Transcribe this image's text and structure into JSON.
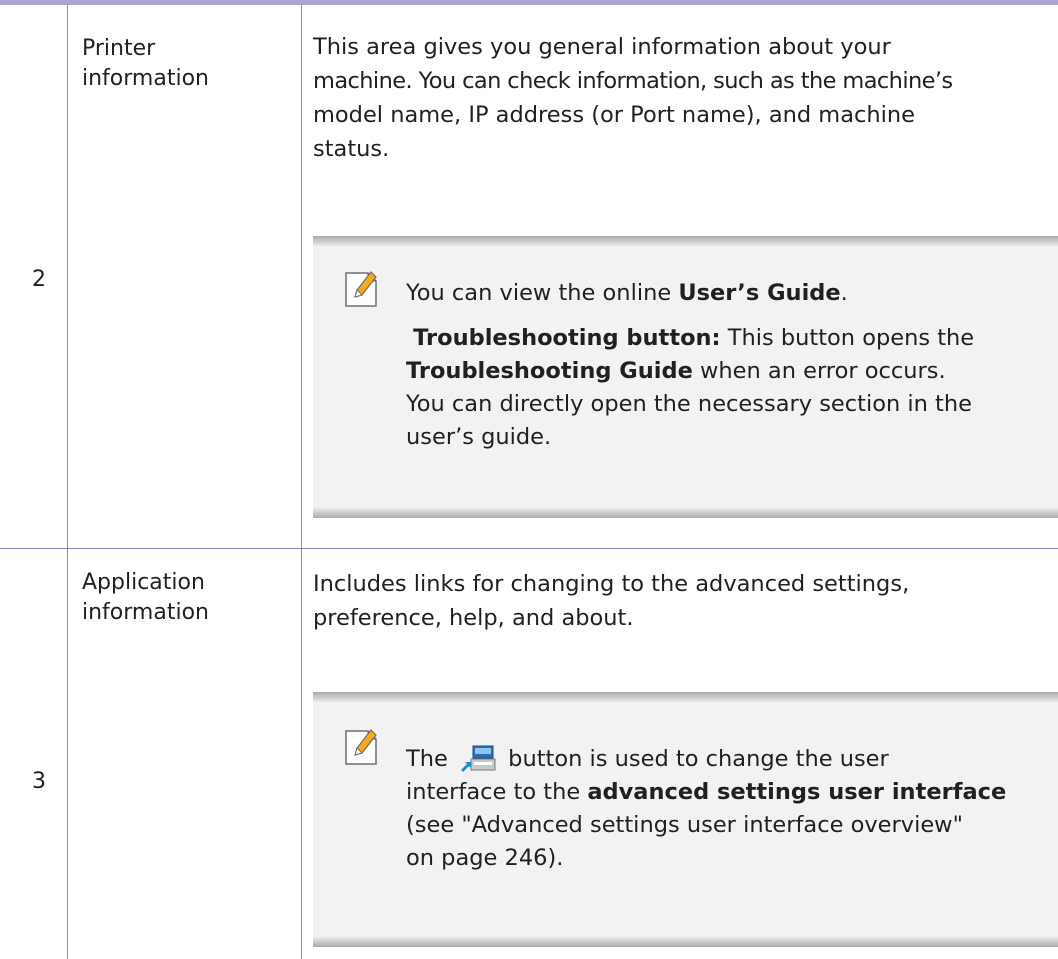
{
  "rows": [
    {
      "number": "2",
      "label_line1": "Printer",
      "label_line2": "information",
      "desc_line1": "This area gives you general information about your",
      "desc_line2": "machine. You can check information, such as the machine’s",
      "desc_line3": "model name, IP address (or Port name), and machine",
      "desc_line4": "status.",
      "note": {
        "icon": "note-pencil-icon",
        "p1_prefix": "You can view the online ",
        "p1_bold": "User’s Guide",
        "p1_suffix": ".",
        "p2_bold": "Troubleshooting button:",
        "p2_text": " This button opens the",
        "p2_bold2": "Troubleshooting Guide",
        "p2_text2": " when an error occurs.",
        "p2_line3": "You can directly open the necessary section in the",
        "p2_line4": "user’s guide."
      }
    },
    {
      "number": "3",
      "label_line1": "Application",
      "label_line2": "information",
      "desc_line1": "Includes links for changing to the advanced settings,",
      "desc_line2": "preference, help, and about.",
      "note": {
        "icon": "note-pencil-icon",
        "inline_icon": "advanced-settings-switch-icon",
        "p1_prefix": "The",
        "p1_suffix": "button is used to change the user",
        "p1_line2_prefix": "interface to the ",
        "p1_line2_bold": "advanced settings user interface",
        "p1_line3": "(see \"Advanced settings user interface overview\"",
        "p1_line4": "on page 246)."
      }
    }
  ],
  "colors": {
    "rule": "#8c88b8",
    "top_bar": "#a9a6d1",
    "note_bg": "#f2f2f2"
  }
}
